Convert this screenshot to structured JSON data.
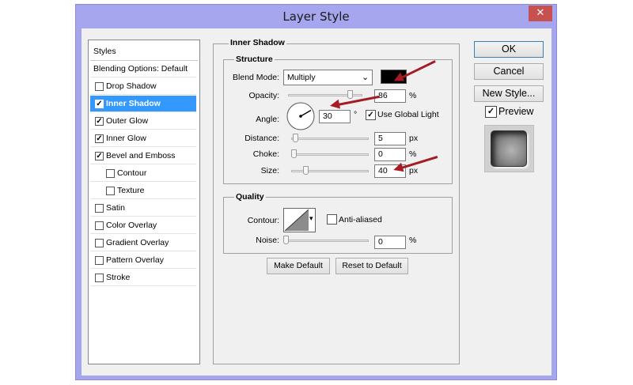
{
  "window": {
    "title": "Layer Style",
    "close_glyph": "✕"
  },
  "styles_panel": {
    "header": "Styles",
    "items": [
      {
        "label": "Blending Options: Default",
        "checkbox": false,
        "checked": false,
        "indent": false,
        "selected": false
      },
      {
        "label": "Drop Shadow",
        "checkbox": true,
        "checked": false,
        "indent": false,
        "selected": false
      },
      {
        "label": "Inner Shadow",
        "checkbox": true,
        "checked": true,
        "indent": false,
        "selected": true
      },
      {
        "label": "Outer Glow",
        "checkbox": true,
        "checked": true,
        "indent": false,
        "selected": false
      },
      {
        "label": "Inner Glow",
        "checkbox": true,
        "checked": true,
        "indent": false,
        "selected": false
      },
      {
        "label": "Bevel and Emboss",
        "checkbox": true,
        "checked": true,
        "indent": false,
        "selected": false
      },
      {
        "label": "Contour",
        "checkbox": true,
        "checked": false,
        "indent": true,
        "selected": false
      },
      {
        "label": "Texture",
        "checkbox": true,
        "checked": false,
        "indent": true,
        "selected": false
      },
      {
        "label": "Satin",
        "checkbox": true,
        "checked": false,
        "indent": false,
        "selected": false
      },
      {
        "label": "Color Overlay",
        "checkbox": true,
        "checked": false,
        "indent": false,
        "selected": false
      },
      {
        "label": "Gradient Overlay",
        "checkbox": true,
        "checked": false,
        "indent": false,
        "selected": false
      },
      {
        "label": "Pattern Overlay",
        "checkbox": true,
        "checked": false,
        "indent": false,
        "selected": false
      },
      {
        "label": "Stroke",
        "checkbox": true,
        "checked": false,
        "indent": false,
        "selected": false
      }
    ]
  },
  "inner_shadow": {
    "title": "Inner Shadow",
    "structure": {
      "title": "Structure",
      "blend_mode": {
        "label": "Blend Mode:",
        "value": "Multiply",
        "color": "#000000"
      },
      "opacity": {
        "label": "Opacity:",
        "value": "86",
        "unit": "%",
        "level": 0.86
      },
      "angle": {
        "label": "Angle:",
        "value": "30",
        "unit": "°",
        "degrees": 30,
        "global_light_label": "Use Global Light",
        "global_light": true
      },
      "distance": {
        "label": "Distance:",
        "value": "5",
        "unit": "px",
        "level": 0.02
      },
      "choke": {
        "label": "Choke:",
        "value": "0",
        "unit": "%",
        "level": 0
      },
      "size": {
        "label": "Size:",
        "value": "40",
        "unit": "px",
        "level": 0.16
      }
    },
    "quality": {
      "title": "Quality",
      "contour_label": "Contour:",
      "anti_aliased_label": "Anti-aliased",
      "anti_aliased": false,
      "noise": {
        "label": "Noise:",
        "value": "0",
        "unit": "%",
        "level": 0
      }
    },
    "make_default": "Make Default",
    "reset_default": "Reset to Default"
  },
  "buttons": {
    "ok": "OK",
    "cancel": "Cancel",
    "new_style": "New Style..."
  },
  "preview": {
    "label": "Preview",
    "checked": true
  },
  "annotation_color": "#a51c24"
}
